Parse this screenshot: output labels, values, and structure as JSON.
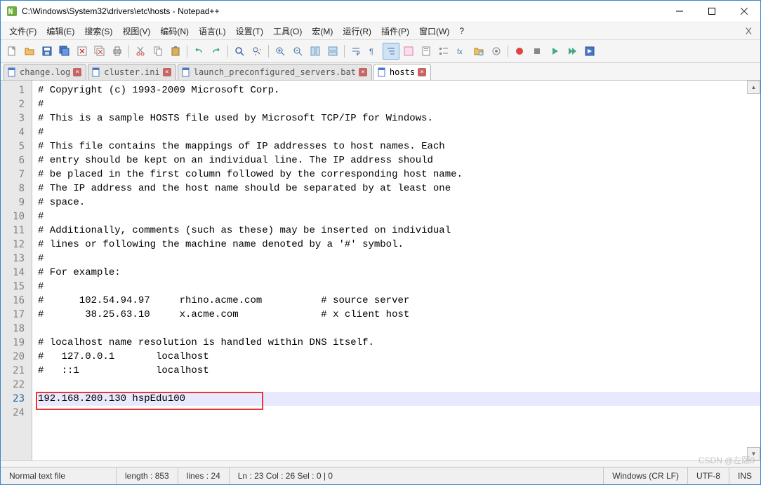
{
  "title": "C:\\Windows\\System32\\drivers\\etc\\hosts - Notepad++",
  "menus": [
    "文件(F)",
    "编辑(E)",
    "搜索(S)",
    "视图(V)",
    "编码(N)",
    "语言(L)",
    "设置(T)",
    "工具(O)",
    "宏(M)",
    "运行(R)",
    "插件(P)",
    "窗口(W)",
    "?"
  ],
  "tabs": [
    {
      "label": "change.log",
      "active": false
    },
    {
      "label": "cluster.ini",
      "active": false
    },
    {
      "label": "launch_preconfigured_servers.bat",
      "active": false
    },
    {
      "label": "hosts",
      "active": true
    }
  ],
  "code_lines": [
    "# Copyright (c) 1993-2009 Microsoft Corp.",
    "#",
    "# This is a sample HOSTS file used by Microsoft TCP/IP for Windows.",
    "#",
    "# This file contains the mappings of IP addresses to host names. Each",
    "# entry should be kept on an individual line. The IP address should",
    "# be placed in the first column followed by the corresponding host name.",
    "# The IP address and the host name should be separated by at least one",
    "# space.",
    "#",
    "# Additionally, comments (such as these) may be inserted on individual",
    "# lines or following the machine name denoted by a '#' symbol.",
    "#",
    "# For example:",
    "#",
    "#      102.54.94.97     rhino.acme.com          # source server",
    "#       38.25.63.10     x.acme.com              # x client host",
    "",
    "# localhost name resolution is handled within DNS itself.",
    "#   127.0.0.1       localhost",
    "#   ::1             localhost",
    "",
    "192.168.200.130 hspEdu100",
    ""
  ],
  "current_line_index": 22,
  "status": {
    "filetype": "Normal text file",
    "length": "length : 853",
    "lines": "lines : 24",
    "pos": "Ln : 23    Col : 26    Sel : 0 | 0",
    "eol": "Windows (CR LF)",
    "encoding": "UTF-8",
    "mode": "INS"
  },
  "watermark": "CSDN @左颐0"
}
